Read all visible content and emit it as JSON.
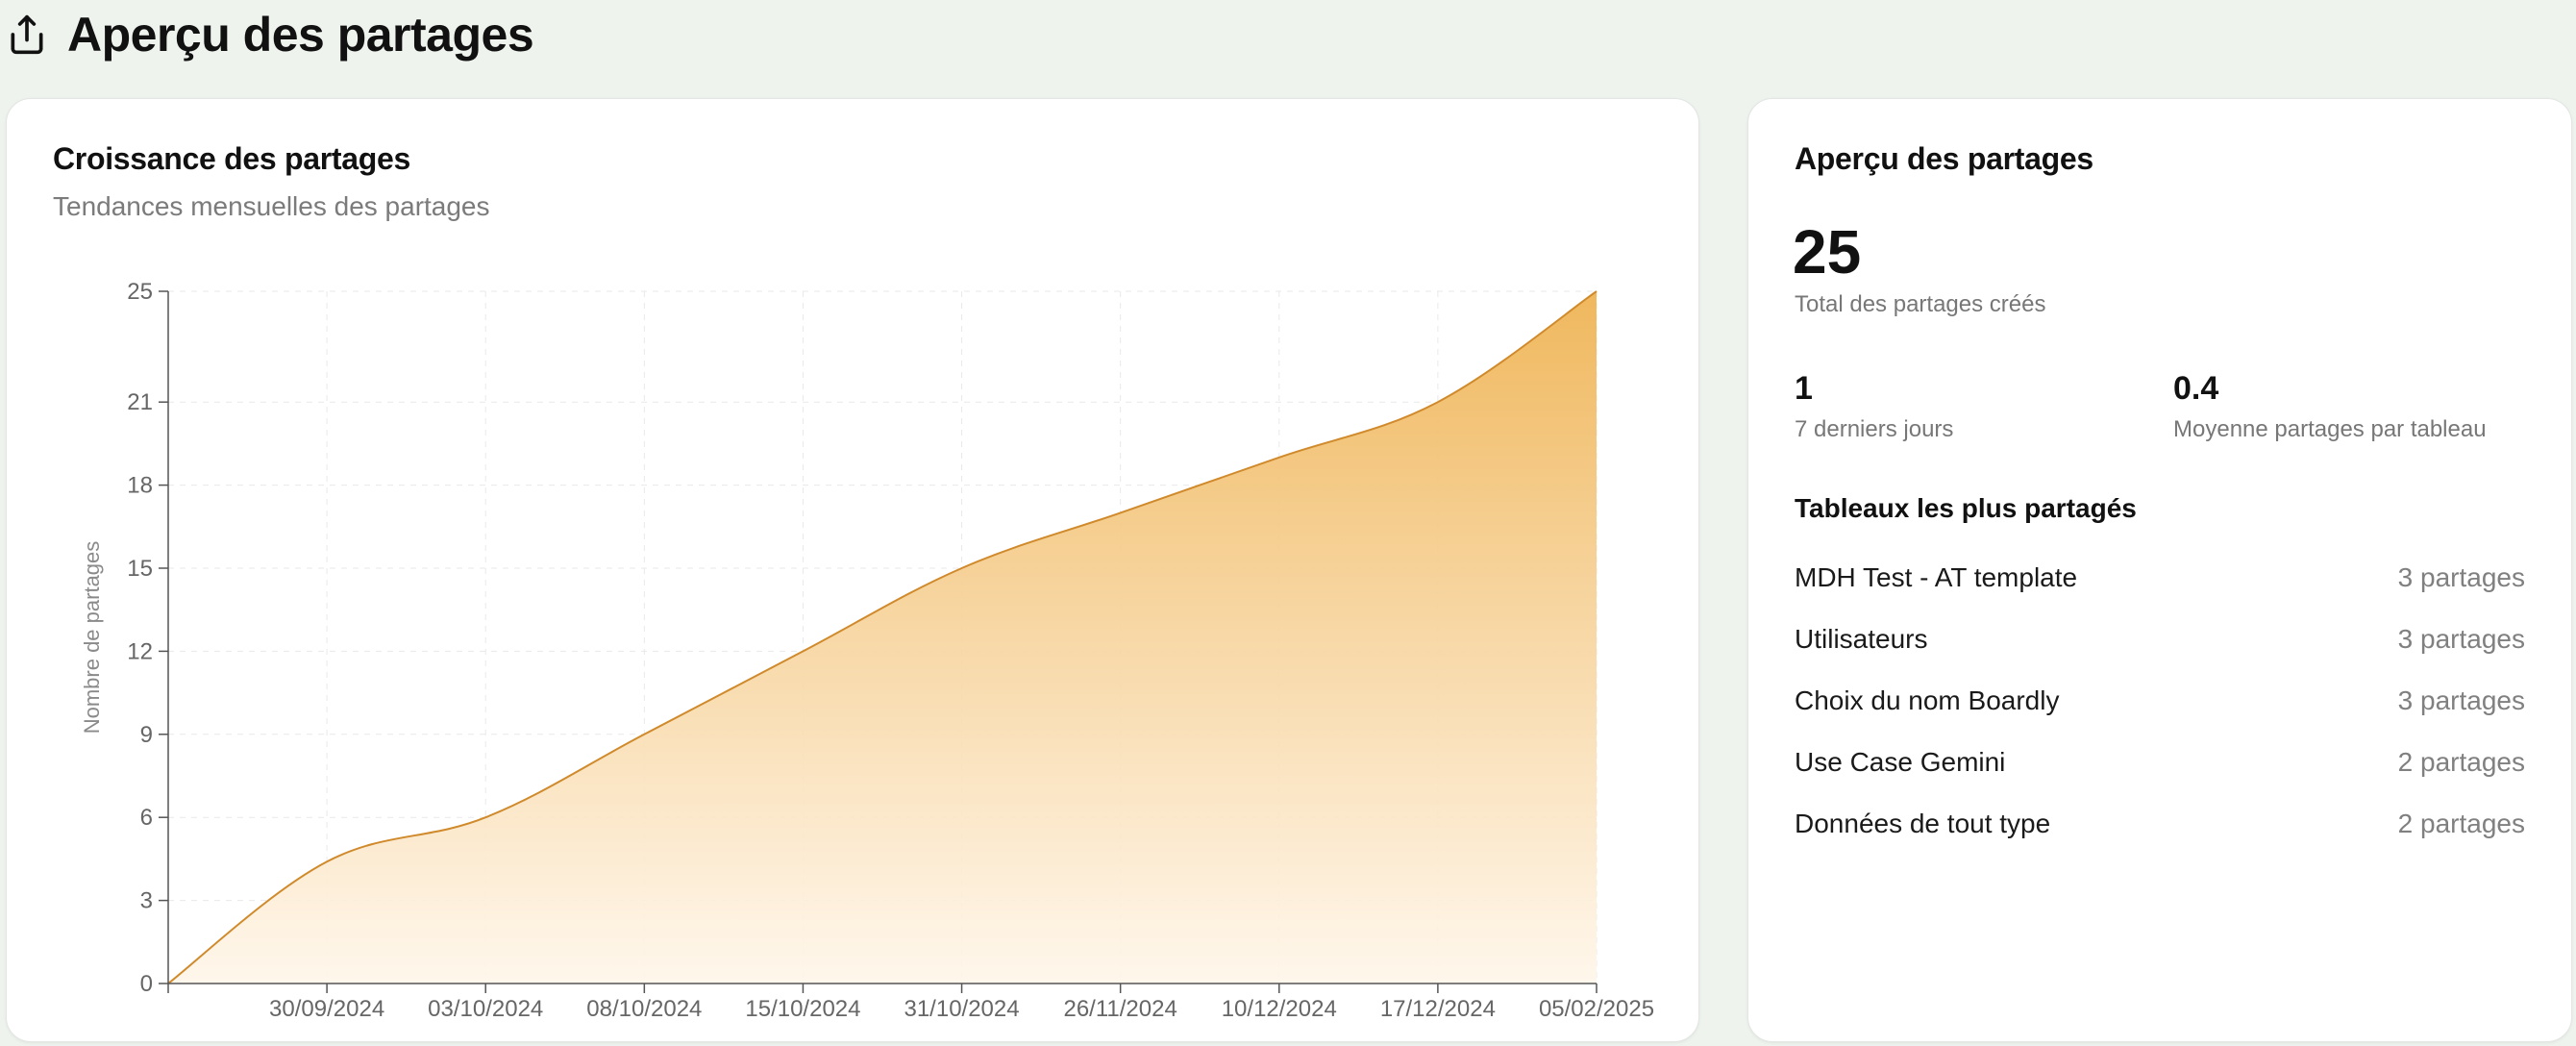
{
  "header": {
    "title": "Aperçu des partages",
    "icon": "share-upload-icon"
  },
  "growth_card": {
    "title": "Croissance des partages",
    "subtitle": "Tendances mensuelles des partages"
  },
  "overview_card": {
    "title": "Aperçu des partages",
    "total": "25",
    "total_label": "Total des partages créés",
    "last7_value": "1",
    "last7_label": "7 derniers jours",
    "avg_value": "0.4",
    "avg_label": "Moyenne partages par tableau",
    "top_title": "Tableaux les plus partagés",
    "boards": [
      {
        "name": "MDH Test - AT template",
        "count": "3 partages"
      },
      {
        "name": "Utilisateurs",
        "count": "3 partages"
      },
      {
        "name": "Choix du nom Boardly",
        "count": "3 partages"
      },
      {
        "name": "Use Case Gemini",
        "count": "2 partages"
      },
      {
        "name": "Données de tout type",
        "count": "2 partages"
      }
    ]
  },
  "chart_data": {
    "type": "area",
    "ylabel": "Nombre de partages",
    "xlabel": "",
    "ylim": [
      0,
      25
    ],
    "yticks": [
      0,
      3,
      6,
      9,
      12,
      15,
      18,
      21,
      25
    ],
    "categories": [
      "",
      "30/09/2024",
      "03/10/2024",
      "08/10/2024",
      "15/10/2024",
      "31/10/2024",
      "26/11/2024",
      "10/12/2024",
      "17/12/2024",
      "05/02/2025"
    ],
    "series": [
      {
        "values": [
          0,
          4.4,
          6,
          9,
          12,
          15,
          17,
          19,
          21,
          25
        ]
      }
    ],
    "grid": true,
    "colors": {
      "line": "#d08a2c",
      "fill_top": "#efb455",
      "fill_bottom": "#fff6ea"
    }
  }
}
